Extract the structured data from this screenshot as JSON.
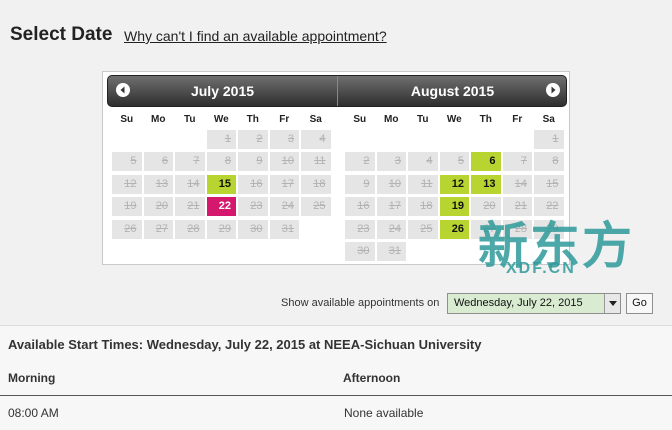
{
  "page": {
    "title": "Select Date",
    "help_link": "Why can't I find an available appointment?"
  },
  "calendar": {
    "weekdays": [
      "Su",
      "Mo",
      "Tu",
      "We",
      "Th",
      "Fr",
      "Sa"
    ],
    "months": [
      {
        "title": "July 2015",
        "weeks": [
          [
            null,
            null,
            null,
            {
              "d": "1",
              "s": "past"
            },
            {
              "d": "2",
              "s": "past"
            },
            {
              "d": "3",
              "s": "past"
            },
            {
              "d": "4",
              "s": "past"
            }
          ],
          [
            {
              "d": "5",
              "s": "past"
            },
            {
              "d": "6",
              "s": "past"
            },
            {
              "d": "7",
              "s": "past"
            },
            {
              "d": "8",
              "s": "past"
            },
            {
              "d": "9",
              "s": "past"
            },
            {
              "d": "10",
              "s": "past"
            },
            {
              "d": "11",
              "s": "past"
            }
          ],
          [
            {
              "d": "12",
              "s": "past"
            },
            {
              "d": "13",
              "s": "past"
            },
            {
              "d": "14",
              "s": "past"
            },
            {
              "d": "15",
              "s": "avail"
            },
            {
              "d": "16",
              "s": "past"
            },
            {
              "d": "17",
              "s": "past"
            },
            {
              "d": "18",
              "s": "past"
            }
          ],
          [
            {
              "d": "19",
              "s": "past"
            },
            {
              "d": "20",
              "s": "past"
            },
            {
              "d": "21",
              "s": "past"
            },
            {
              "d": "22",
              "s": "selected"
            },
            {
              "d": "23",
              "s": "past"
            },
            {
              "d": "24",
              "s": "past"
            },
            {
              "d": "25",
              "s": "past"
            }
          ],
          [
            {
              "d": "26",
              "s": "past"
            },
            {
              "d": "27",
              "s": "past"
            },
            {
              "d": "28",
              "s": "past"
            },
            {
              "d": "29",
              "s": "past"
            },
            {
              "d": "30",
              "s": "past"
            },
            {
              "d": "31",
              "s": "past"
            },
            null
          ]
        ]
      },
      {
        "title": "August 2015",
        "weeks": [
          [
            null,
            null,
            null,
            null,
            null,
            null,
            {
              "d": "1",
              "s": "past"
            }
          ],
          [
            {
              "d": "2",
              "s": "past"
            },
            {
              "d": "3",
              "s": "past"
            },
            {
              "d": "4",
              "s": "past"
            },
            {
              "d": "5",
              "s": "past"
            },
            {
              "d": "6",
              "s": "avail"
            },
            {
              "d": "7",
              "s": "past"
            },
            {
              "d": "8",
              "s": "past"
            }
          ],
          [
            {
              "d": "9",
              "s": "past"
            },
            {
              "d": "10",
              "s": "past"
            },
            {
              "d": "11",
              "s": "past"
            },
            {
              "d": "12",
              "s": "avail"
            },
            {
              "d": "13",
              "s": "avail"
            },
            {
              "d": "14",
              "s": "past"
            },
            {
              "d": "15",
              "s": "past"
            }
          ],
          [
            {
              "d": "16",
              "s": "past"
            },
            {
              "d": "17",
              "s": "past"
            },
            {
              "d": "18",
              "s": "past"
            },
            {
              "d": "19",
              "s": "avail"
            },
            {
              "d": "20",
              "s": "past"
            },
            {
              "d": "21",
              "s": "past"
            },
            {
              "d": "22",
              "s": "past"
            }
          ],
          [
            {
              "d": "23",
              "s": "past"
            },
            {
              "d": "24",
              "s": "past"
            },
            {
              "d": "25",
              "s": "past"
            },
            {
              "d": "26",
              "s": "avail"
            },
            {
              "d": "27",
              "s": "past"
            },
            {
              "d": "28",
              "s": "past"
            },
            {
              "d": "29",
              "s": "past"
            }
          ],
          [
            {
              "d": "30",
              "s": "past"
            },
            {
              "d": "31",
              "s": "past"
            },
            null,
            null,
            null,
            null,
            null
          ]
        ]
      }
    ],
    "nav_icons": {
      "prev": "chevron-left-icon",
      "next": "chevron-right-icon"
    }
  },
  "watermark": {
    "text_cn": "新东方",
    "text_en": "XDF.CN"
  },
  "date_picker": {
    "label": "Show available appointments on",
    "selected": "Wednesday, July 22, 2015",
    "go_label": "Go"
  },
  "availability": {
    "title": "Available Start Times: Wednesday, July 22, 2015 at NEEA-Sichuan University",
    "morning_header": "Morning",
    "afternoon_header": "Afternoon",
    "morning_slots": [
      "08:00 AM"
    ],
    "afternoon_slots": [
      "None available"
    ]
  },
  "colors": {
    "available": "#b8d431",
    "selected": "#d4186d",
    "past": "#e5e5e5",
    "watermark": "#2f9a9b"
  }
}
